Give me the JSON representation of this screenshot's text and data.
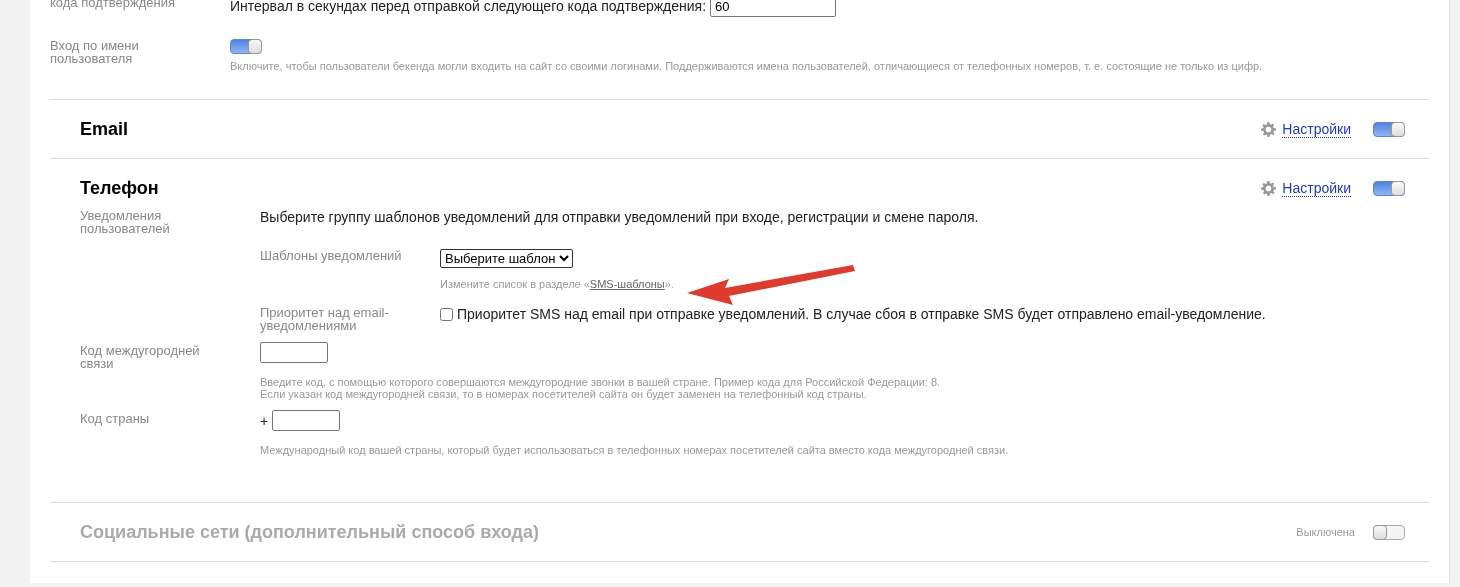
{
  "top_rows": [
    {
      "label": "кода подтверждения",
      "text": "Интервал в секундах перед отправкой следующего кода подтверждения:",
      "value": "60"
    },
    {
      "label": "Вход по имени пользователя",
      "on": true,
      "hint": "Включите, чтобы пользователи бекенда могли входить на сайт со своими логинами. Поддерживаются имена пользователей, отличающиеся от телефонных номеров, т. е. состоящие не только из цифр."
    }
  ],
  "sections": [
    {
      "title": "Email",
      "enabled": true,
      "settings_link": "Настройки"
    },
    {
      "title": "Телефон",
      "enabled": true,
      "settings_link": "Настройки",
      "notifications": {
        "label": "Уведомления пользователей",
        "intro": "Выберите группу шаблонов уведомлений для отправки уведомлений при входе, регистрации и смене пароля.",
        "template_label": "Шаблоны уведомлений",
        "template_value": "Выберите шаблон",
        "template_hint_before": "Измените список в разделе «",
        "template_hint_link": "SMS-шаблоны",
        "template_hint_after": "».",
        "priority_label": "Приоритет над email-уведомлениями",
        "priority_checked": false,
        "priority_text": "Приоритет SMS над email при отправке уведомлений. В случае сбоя в отправке SMS будет отправлено email-уведомление."
      },
      "fields": [
        {
          "label": "Код междугородней связи",
          "hint_lines": [
            "Введите код, с помощью которого совершаются междугородние звонки в вашей стране. Пример кода для Российской Федерации: 8.",
            "Если указан код междугородней связи, то в номерах посетителей сайта он будет заменен на телефонный код страны."
          ]
        },
        {
          "label": "Код страны",
          "prefix": "+",
          "hint_lines": [
            "Международный код вашей страны, который будет использоваться в телефонных номерах посетителей сайта вместо кода междугородней связи."
          ]
        }
      ]
    },
    {
      "title": "Социальные сети (дополнительный способ входа)",
      "enabled": false,
      "status": "Выключена"
    }
  ]
}
